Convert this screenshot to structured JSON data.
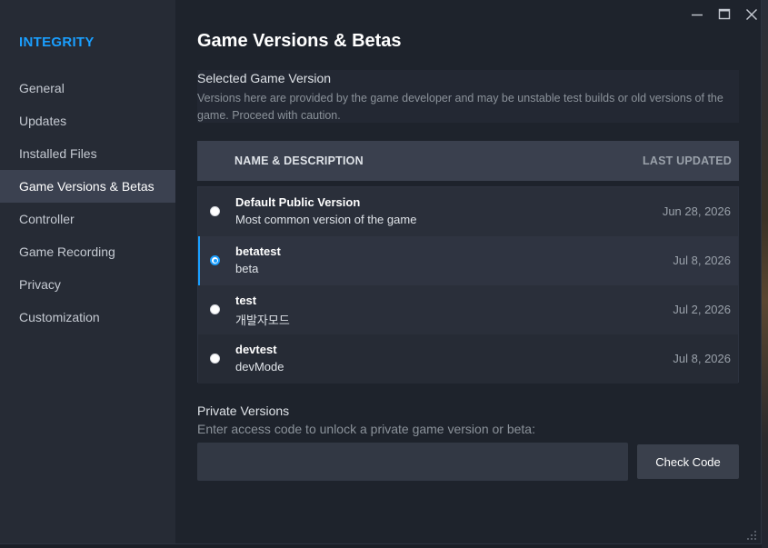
{
  "sidebar": {
    "game_title": "INTEGRITY",
    "items": [
      {
        "label": "General"
      },
      {
        "label": "Updates"
      },
      {
        "label": "Installed Files"
      },
      {
        "label": "Game Versions & Betas"
      },
      {
        "label": "Controller"
      },
      {
        "label": "Game Recording"
      },
      {
        "label": "Privacy"
      },
      {
        "label": "Customization"
      }
    ],
    "active_index": 3
  },
  "page": {
    "title": "Game Versions & Betas",
    "selected_heading": "Selected Game Version",
    "selected_desc": "Versions here are provided by the game developer and may be unstable test builds or old versions of the game. Proceed with caution."
  },
  "table": {
    "col_name": "NAME & DESCRIPTION",
    "col_updated": "LAST UPDATED",
    "rows": [
      {
        "name": "Default Public Version",
        "desc": "Most common version of the game",
        "date": "Jun 28, 2026",
        "selected": false
      },
      {
        "name": "betatest",
        "desc": "beta",
        "date": "Jul 8, 2026",
        "selected": true
      },
      {
        "name": "test",
        "desc": "개발자모드",
        "date": "Jul 2, 2026",
        "selected": false
      },
      {
        "name": "devtest",
        "desc": "devMode",
        "date": "Jul 8, 2026",
        "selected": false
      }
    ]
  },
  "private": {
    "heading": "Private Versions",
    "desc": "Enter access code to unlock a private game version or beta:",
    "input_value": "",
    "button_label": "Check Code"
  },
  "titlebar": {
    "icons": [
      "minimize-icon",
      "maximize-icon",
      "close-icon"
    ]
  },
  "colors": {
    "accent": "#1a9fff",
    "sidebar_bg": "#262b35",
    "content_bg": "#1e232c",
    "table_header_bg": "#3a404e"
  }
}
